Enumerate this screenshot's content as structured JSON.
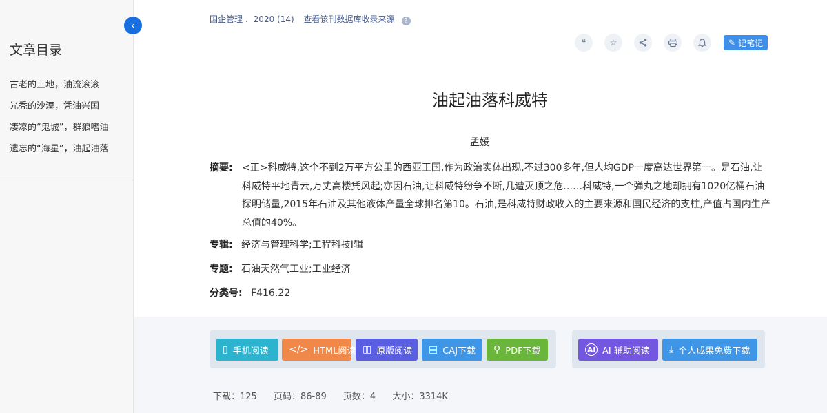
{
  "sidebar": {
    "title": "文章目录",
    "items": [
      {
        "label": "古老的土地，油流滚滚"
      },
      {
        "label": "光秃的沙漠，凭油兴国"
      },
      {
        "label": "凄凉的“鬼城”，群狼嗜油"
      },
      {
        "label": "遗忘的“海星”，油起油落"
      }
    ],
    "collapse_glyph": "‹"
  },
  "source": {
    "journal": "国企管理",
    "sep": ".",
    "issue": "2020 (14)",
    "link": "查看该刊数据库收录来源",
    "help_glyph": "?"
  },
  "toolbar": {
    "cite": {
      "icon": "quote-icon",
      "glyph": "❝"
    },
    "favorite": {
      "icon": "star-icon",
      "glyph": "☆"
    },
    "share": {
      "icon": "share-icon",
      "glyph": "⋖"
    },
    "print": {
      "icon": "printer-icon",
      "glyph": "⎙"
    },
    "subscribe": {
      "icon": "bell-icon",
      "glyph": "♫"
    },
    "note_label": "记笔记",
    "note_glyph": "✎"
  },
  "article": {
    "title": "油起油落科威特",
    "author": "孟媛",
    "abstract_label": "摘要:",
    "abstract": "<正>科威特,这个不到2万平方公里的西亚王国,作为政治实体出现,不过300多年,但人均GDP一度高达世界第一。是石油,让科威特平地青云,万丈高楼凭风起;亦因石油,让科威特纷争不断,几遭灭顶之危……科威特,一个弹丸之地却拥有1020亿桶石油探明储量,2015年石油及其他液体产量全球排名第10。石油,是科威特财政收入的主要来源和国民经济的支柱,产值占国内生产总值的40%。",
    "series_label": "专辑:",
    "series": "经济与管理科学;工程科技Ⅰ辑",
    "topic_label": "专题:",
    "topic": "石油天然气工业;工业经济",
    "class_label": "分类号:",
    "class_no": "F416.22"
  },
  "actions": {
    "mobile": {
      "label": "手机阅读",
      "glyph": "▯",
      "color": "#2cb4cf"
    },
    "html": {
      "label": "HTML阅读",
      "glyph": "</>",
      "color": "#f0884a"
    },
    "original": {
      "label": "原版阅读",
      "glyph": "▥",
      "color": "#5a5ee0"
    },
    "caj": {
      "label": "CAJ下载",
      "glyph": "▤",
      "color": "#3f95e6"
    },
    "pdf": {
      "label": "PDF下载",
      "glyph": "⚲",
      "color": "#6ab63a"
    },
    "ai": {
      "label": "AI 辅助阅读",
      "glyph": "Ai",
      "color": "#7357e0"
    },
    "personal": {
      "label": "个人成果免费下载",
      "glyph": "⤓",
      "color": "#3f95e6"
    }
  },
  "stats": {
    "downloads": "下载：125",
    "pages": "页码：86-89",
    "page_count": "页数：4",
    "size": "大小：3314K"
  }
}
